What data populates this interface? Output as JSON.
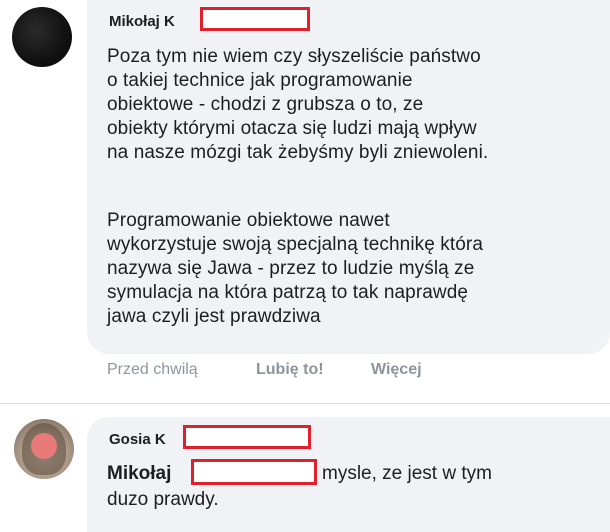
{
  "comments": [
    {
      "author": "Mikołaj K",
      "paragraphs": [
        "Poza tym nie wiem czy słyszeliście państwo\no takiej technice jak programowanie\nobiektowe - chodzi z grubsza o to, ze\nobiekty którymi otacza się ludzi mają wpływ\nna nasze mózgi tak żebyśmy byli zniewoleni.",
        "Programowanie obiektowe nawet\nwykorzystuje swoją specjalną technikę która\nnazywa się Jawa - przez to ludzie myślą ze\nsymulacja na która patrzą to tak naprawdę\njawa czyli jest prawdziwa"
      ],
      "actions": {
        "time": "Przed chwilą",
        "like": "Lubię to!",
        "more": "Więcej"
      }
    },
    {
      "author": "Gosia K",
      "mention": "Mikołaj",
      "text_after_mention": "mysle, ze jest w tym",
      "text_line2": "duzo prawdy."
    }
  ],
  "colors": {
    "bubble": "#f0f2f5",
    "redaction": "#e0202a",
    "muted_text": "#8d949e"
  }
}
